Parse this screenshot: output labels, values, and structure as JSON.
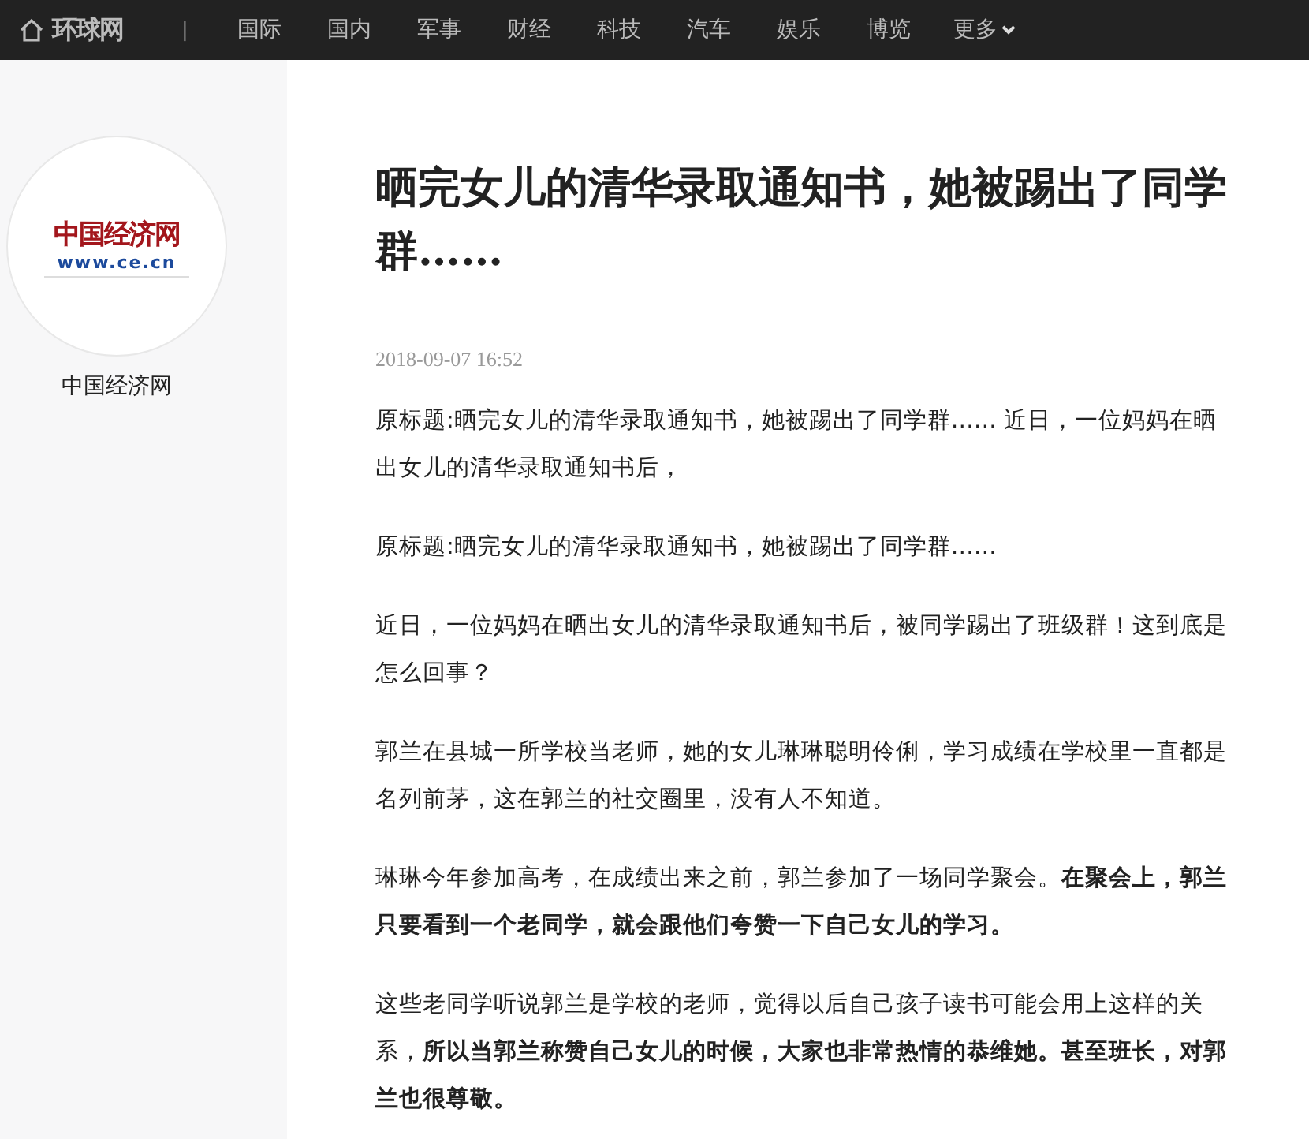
{
  "top_nav": {
    "site_name": "环球网",
    "separator": "|",
    "items": [
      {
        "label": "国际"
      },
      {
        "label": "国内"
      },
      {
        "label": "军事"
      },
      {
        "label": "财经"
      },
      {
        "label": "科技"
      },
      {
        "label": "汽车"
      },
      {
        "label": "娱乐"
      },
      {
        "label": "博览"
      }
    ],
    "more": "更多"
  },
  "sidebar": {
    "logo": {
      "name": "中国经济网",
      "url": "www.ce.cn"
    },
    "source_name": "中国经济网"
  },
  "article": {
    "title": "晒完女儿的清华录取通知书，她被踢出了同学群……",
    "date": "2018-09-07 16:52",
    "paragraphs": [
      "原标题:晒完女儿的清华录取通知书，她被踢出了同学群…… 近日，一位妈妈在晒出女儿的清华录取通知书后，",
      "原标题:晒完女儿的清华录取通知书，她被踢出了同学群……",
      "近日，一位妈妈在晒出女儿的清华录取通知书后，被同学踢出了班级群！这到底是怎么回事？",
      "郭兰在县城一所学校当老师，她的女儿琳琳聪明伶俐，学习成绩在学校里一直都是名列前茅，这在郭兰的社交圈里，没有人不知道。",
      "琳琳今年参加高考，在成绩出来之前，郭兰参加了一场同学聚会。**在聚会上，郭兰只要看到一个老同学，就会跟他们夸赞一下自己女儿的学习。**",
      "这些老同学听说郭兰是学校的老师，觉得以后自己孩子读书可能会用上这样的关系，**所以当郭兰称赞自己女儿的时候，大家也非常热情的恭维她。甚至班长，对郭兰也很尊敬。**"
    ]
  }
}
